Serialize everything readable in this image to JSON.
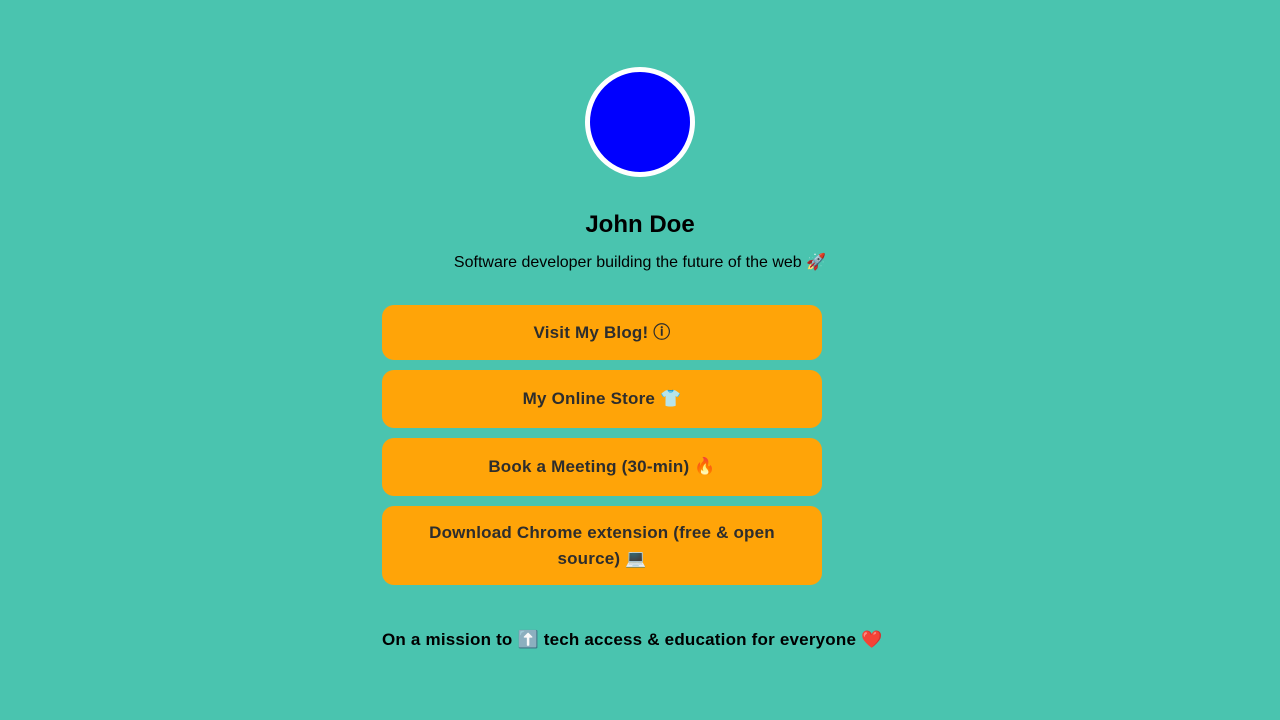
{
  "profile": {
    "avatar_color": "#0000ff",
    "name": "John Doe",
    "bio": "Software developer building the future of the web 🚀"
  },
  "links": [
    {
      "label": "Visit My Blog! ⓘ"
    },
    {
      "label": "My Online Store 👕"
    },
    {
      "label": "Book a Meeting (30-min) 🔥"
    },
    {
      "label": "Download Chrome extension (free & open source) 💻"
    }
  ],
  "footer": {
    "mission": "On a mission to ⬆️ tech access & education for everyone ❤️"
  },
  "colors": {
    "background": "#4ac4af",
    "button": "#ffa408",
    "button_text": "#2d2d2d"
  }
}
